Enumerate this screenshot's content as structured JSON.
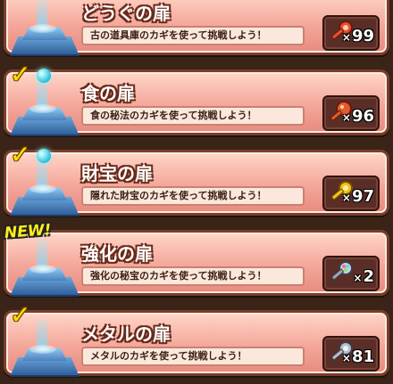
{
  "doors": [
    {
      "title": "どうぐの扉",
      "desc": "古の道具庫のカギを使って挑戦しよう！",
      "count": "99",
      "cleared": true,
      "new": false,
      "key_icon": "red-key-icon",
      "key_color": "#e8502e"
    },
    {
      "title": "食の扉",
      "desc": "食の秘法のカギを使って挑戦しよう！",
      "count": "96",
      "cleared": true,
      "new": false,
      "key_icon": "orange-key-icon",
      "key_color": "#e55a2a"
    },
    {
      "title": "財宝の扉",
      "desc": "隠れた財宝のカギを使って挑戦しよう！",
      "count": "97",
      "cleared": true,
      "new": false,
      "key_icon": "gold-key-icon",
      "key_color": "#f2c21a"
    },
    {
      "title": "強化の扉",
      "desc": "強化の秘宝のカギを使って挑戦しよう！",
      "count": "2",
      "cleared": false,
      "new": true,
      "new_label": "NEW!",
      "key_icon": "jewel-key-icon",
      "key_color": "#c9d3e0"
    },
    {
      "title": "メタルの扉",
      "desc": "メタルのカギを使って挑戦しよう！",
      "count": "81",
      "cleared": true,
      "new": false,
      "key_icon": "metal-key-icon",
      "key_color": "#b7bec8"
    }
  ],
  "count_prefix": "×"
}
